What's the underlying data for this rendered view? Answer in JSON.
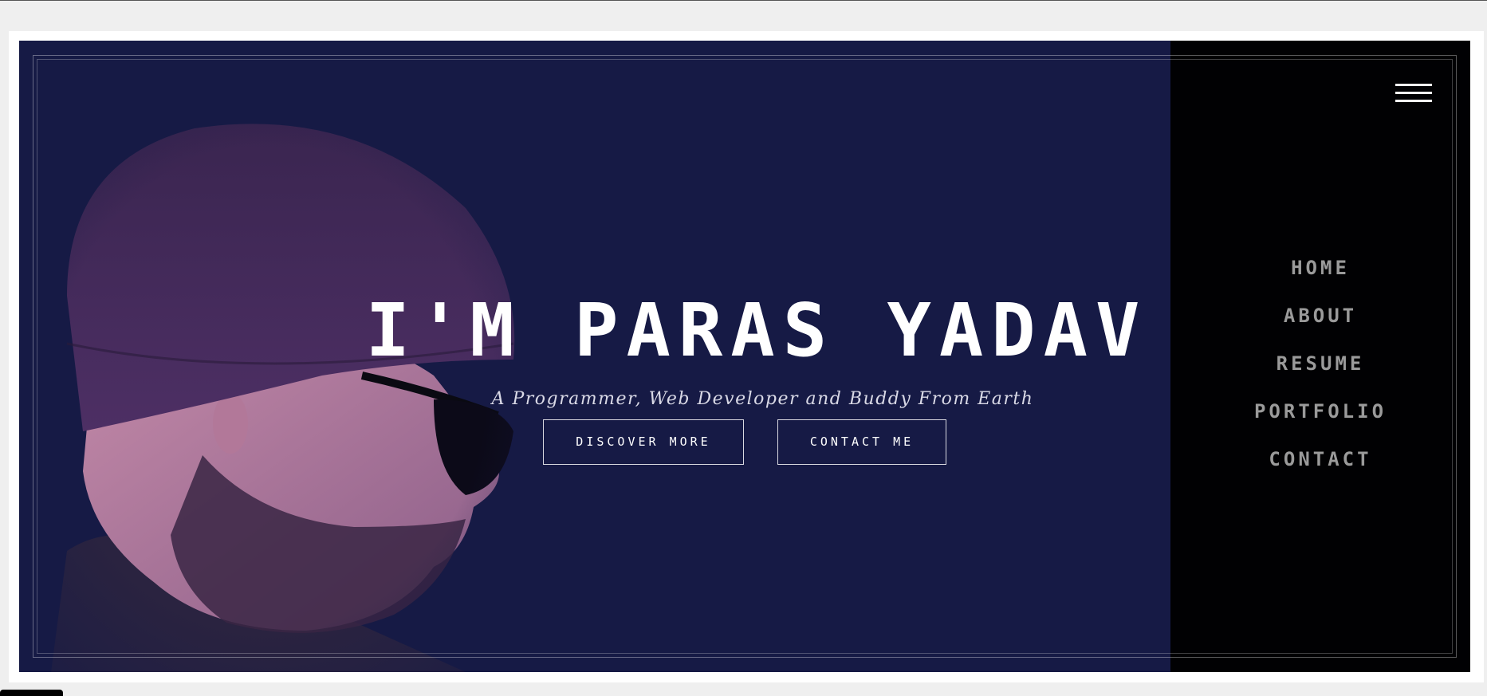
{
  "hero": {
    "headline": "I'M PARAS YADAV",
    "subline": "A Programmer, Web Developer and Buddy From Earth",
    "buttons": {
      "discover": "DISCOVER MORE",
      "contact": "CONTACT ME"
    }
  },
  "nav": {
    "menu_icon": "hamburger-menu-icon",
    "items": [
      {
        "label": "HOME"
      },
      {
        "label": "ABOUT"
      },
      {
        "label": "RESUME"
      },
      {
        "label": "PORTFOLIO"
      },
      {
        "label": "CONTACT"
      }
    ]
  },
  "colors": {
    "hero_bg": "#161a45",
    "sidebar_bg": "#010103",
    "nav_text": "#9a9a9a",
    "headline": "#ffffff"
  }
}
